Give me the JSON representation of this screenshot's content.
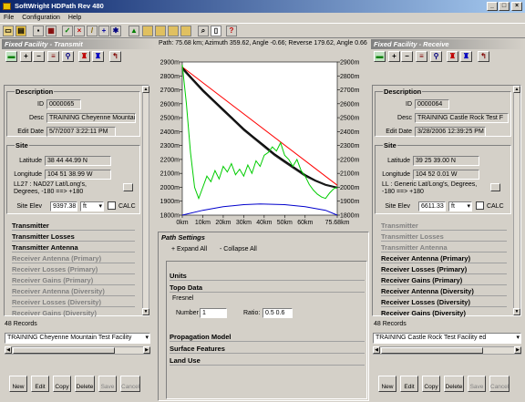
{
  "app": {
    "title": "SoftWright HDPath Rev 480",
    "win_buttons": [
      "_",
      "□",
      "×"
    ]
  },
  "menu": [
    "File",
    "Configuration",
    "Help"
  ],
  "toolbar_icons": [
    "new-icon",
    "open-icon",
    "save-icon",
    "print-icon",
    "check-icon",
    "delete-icon",
    "pencil-icon",
    "crosshair-icon",
    "star-icon",
    "map-icon",
    "folder-icon",
    "folder-icon",
    "folder-icon",
    "folder-icon",
    "search-icon",
    "page-icon",
    "help-icon"
  ],
  "path_info": "Path: 75.68 km; Azimuth 359.62, Angle -0.66; Reverse 179.62, Angle 0.66",
  "transmit": {
    "header": "Fixed Facility - Transmit",
    "buttons": [
      "select",
      "+",
      "-",
      "list",
      "find",
      "tower",
      "tower2",
      "route"
    ],
    "description": {
      "title": "Description",
      "id_label": "ID",
      "id": "0000065",
      "desc_label": "Desc",
      "desc": "TRAINING Cheyenne Mountain",
      "edit_label": "Edit Date",
      "edit": "5/7/2007 3:22:11 PM"
    },
    "site": {
      "title": "Site",
      "lat_label": "Latitude",
      "lat": "38 44 44.99 N",
      "lon_label": "Longitude",
      "lon": "104 51 38.99 W",
      "datum": "LL27 : NAD27 Lat/Long's, Degrees, -180 ==> +180",
      "elev_label": "Site Elev",
      "elev": "9397.38",
      "elev_unit": "ft",
      "calc": "CALC"
    },
    "sections": [
      {
        "label": "Transmitter",
        "enabled": true
      },
      {
        "label": "Transmitter Losses",
        "enabled": true
      },
      {
        "label": "Transmitter Antenna",
        "enabled": true
      },
      {
        "label": "Receiver Antenna (Primary)",
        "enabled": false
      },
      {
        "label": "Receiver Losses (Primary)",
        "enabled": false
      },
      {
        "label": "Receiver Gains (Primary)",
        "enabled": false
      },
      {
        "label": "Receiver Antenna (Diversity)",
        "enabled": false
      },
      {
        "label": "Receiver Losses (Diversity)",
        "enabled": false
      },
      {
        "label": "Receiver Gains (Diversity)",
        "enabled": false
      }
    ],
    "records": "48 Records",
    "selected": "TRAINING Cheyenne Mountain Test Facility",
    "action_buttons": [
      "New",
      "Edit",
      "Copy",
      "Delete",
      "Save",
      "Cancel"
    ]
  },
  "receive": {
    "header": "Fixed Facility - Receive",
    "buttons": [
      "select",
      "+",
      "-",
      "list",
      "find",
      "tower",
      "tower2",
      "route"
    ],
    "description": {
      "title": "Description",
      "id_label": "ID",
      "id": "0000064",
      "desc_label": "Desc",
      "desc": "TRAINING Castle Rock Test F",
      "edit_label": "Edit Date",
      "edit": "3/28/2006 12:39:25 PM"
    },
    "site": {
      "title": "Site",
      "lat_label": "Latitude",
      "lat": "39 25 39.00 N",
      "lon_label": "Longitude",
      "lon": "104 52 0.01 W",
      "datum": "LL : Generic Lat/Long's, Degrees, -180 ==> +180",
      "elev_label": "Site Elev",
      "elev": "6611.33",
      "elev_unit": "ft",
      "calc": "CALC"
    },
    "sections": [
      {
        "label": "Transmitter",
        "enabled": false
      },
      {
        "label": "Transmitter Losses",
        "enabled": false
      },
      {
        "label": "Transmitter Antenna",
        "enabled": false
      },
      {
        "label": "Receiver Antenna (Primary)",
        "enabled": true
      },
      {
        "label": "Receiver Losses (Primary)",
        "enabled": true
      },
      {
        "label": "Receiver Gains (Primary)",
        "enabled": true
      },
      {
        "label": "Receiver Antenna (Diversity)",
        "enabled": true
      },
      {
        "label": "Receiver Losses (Diversity)",
        "enabled": true
      },
      {
        "label": "Receiver Gains (Diversity)",
        "enabled": true
      }
    ],
    "records": "48 Records",
    "selected": "TRAINING Castle Rock Test Facility ed",
    "action_buttons": [
      "New",
      "Edit",
      "Copy",
      "Delete",
      "Save",
      "Cancel"
    ]
  },
  "path_settings": {
    "header": "Path Settings",
    "expand": "+ Expand All",
    "collapse": "- Collapse All",
    "sections": [
      "Units",
      "Topo Data",
      "Propagation Model",
      "Surface Features",
      "Land Use"
    ],
    "fresnel": {
      "title": "Fresnel",
      "number_label": "Number",
      "number": "1",
      "ratio_label": "Ratio:",
      "ratio": "0.5 0.6"
    }
  },
  "chart_data": {
    "type": "line",
    "xlabel": "",
    "ylabel": "",
    "x_ticks": [
      "0km",
      "10km",
      "20km",
      "30km",
      "40km",
      "50km",
      "60km",
      "75.68km"
    ],
    "y_ticks": [
      "1800m",
      "1900m",
      "2000m",
      "2100m",
      "2200m",
      "2300m",
      "2400m",
      "2500m",
      "2600m",
      "2700m",
      "2800m",
      "2900m"
    ],
    "xlim": [
      0,
      75.68
    ],
    "ylim": [
      1800,
      2900
    ],
    "grid": false,
    "series": [
      {
        "color": "#ff0000",
        "x": [
          0,
          75.68
        ],
        "y": [
          2864,
          2015
        ]
      },
      {
        "color": "#000000",
        "x": [
          0,
          5,
          10,
          15,
          20,
          25,
          30,
          35,
          40,
          45,
          50,
          55,
          60,
          65,
          70,
          75.68
        ],
        "y": [
          2860,
          2780,
          2700,
          2630,
          2560,
          2490,
          2420,
          2360,
          2300,
          2240,
          2190,
          2140,
          2090,
          2050,
          2020,
          2000
        ]
      },
      {
        "color": "#202020",
        "x": [
          0,
          5,
          10,
          15,
          20,
          25,
          30,
          35,
          40,
          45,
          50,
          55,
          60,
          65,
          70,
          75.68
        ],
        "y": [
          2850,
          2770,
          2690,
          2620,
          2550,
          2480,
          2410,
          2350,
          2290,
          2230,
          2180,
          2130,
          2080,
          2045,
          2015,
          1995
        ]
      },
      {
        "color": "#00cc00",
        "x": [
          0,
          2,
          4,
          6,
          8,
          10,
          12,
          14,
          16,
          18,
          20,
          22,
          24,
          26,
          28,
          30,
          32,
          34,
          36,
          38,
          40,
          42,
          44,
          46,
          48,
          50,
          52,
          54,
          56,
          58,
          60,
          62,
          64,
          66,
          68,
          70,
          72,
          74,
          75.68
        ],
        "y": [
          2880,
          2600,
          2250,
          2000,
          1920,
          2000,
          2080,
          2040,
          2120,
          2060,
          2150,
          2110,
          2170,
          2090,
          2130,
          2080,
          2160,
          2100,
          2190,
          2150,
          2230,
          2250,
          2290,
          2260,
          2320,
          2230,
          2200,
          2150,
          2200,
          2120,
          2080,
          2020,
          1980,
          1950,
          1930,
          1920,
          1960,
          1990,
          2000
        ]
      },
      {
        "color": "#0000cc",
        "x": [
          0,
          10,
          20,
          30,
          38,
          50,
          60,
          70,
          75.68
        ],
        "y": [
          1800,
          1835,
          1860,
          1875,
          1880,
          1875,
          1860,
          1835,
          1800
        ]
      }
    ]
  }
}
